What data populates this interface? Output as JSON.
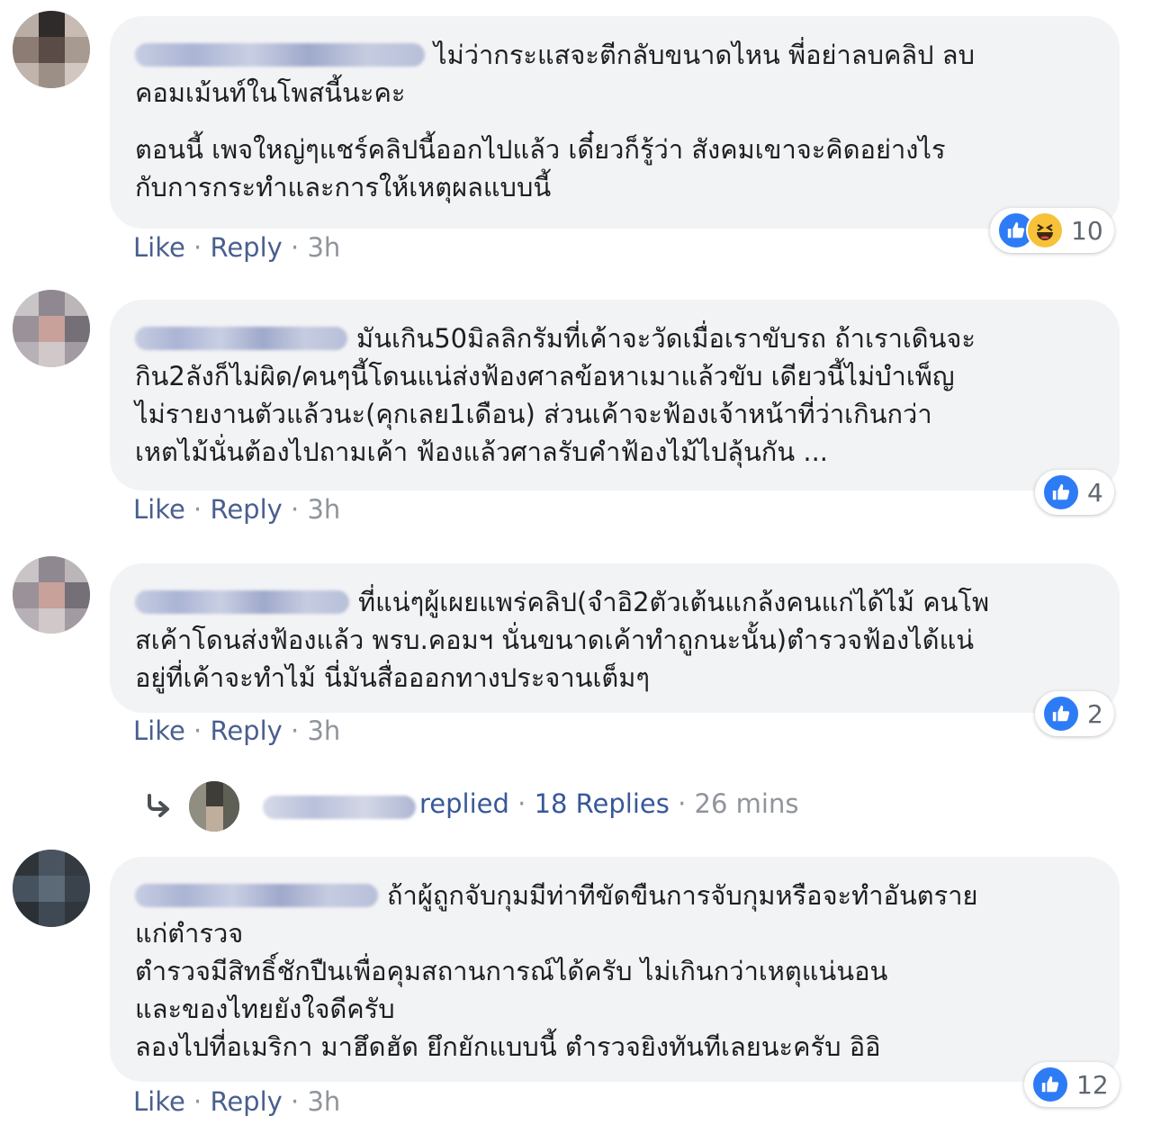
{
  "comments": [
    {
      "lines": [
        "ไม่ว่ากระแสจะตีกลับขนาดไหน พี่อย่าลบคลิป ลบ",
        "คอมเม้นท์ในโพสนี้นะคะ"
      ],
      "lines2": [
        "ตอนนี้ เพจใหญ่ๆแชร์คลิปนี้ออกไปแล้ว เดี๋ยวก็รู้ว่า สังคมเขาจะคิดอย่างไร",
        "กับการกระทำและการให้เหตุผลแบบนี้"
      ],
      "like": "Like",
      "reply": "Reply",
      "time": "3h",
      "reaction_count": "10"
    },
    {
      "lines": [
        "มันเกิน50มิลลิกรัมที่เค้าจะวัดเมื่อเราขับรถ ถ้าเราเดินจะ",
        "กิน2ลังก็ไม่ผิด/คนๆนี้โดนแน่ส่งฟ้องศาลข้อหาเมาแล้วขับ เดียวนี้ไม่บำเพ็ญ",
        "ไม่รายงานตัวแล้วนะ(คุกเลย1เดือน) ส่วนเค้าจะฟ้องเจ้าหน้าที่ว่าเกินกว่า",
        "เหตไม้นั่นต้องไปถามเค้า ฟ้องแล้วศาลรับคำฟ้องไม้ไปลุ้นกัน ..."
      ],
      "like": "Like",
      "reply": "Reply",
      "time": "3h",
      "reaction_count": "4"
    },
    {
      "lines": [
        "ที่แน่ๆผู้เผยแพร่คลิป(จำอิ2ตัวเต้นแกล้งคนแก่ได้ไม้ คนโพ",
        "สเค้าโดนส่งฟ้องแล้ว พรบ.คอมฯ นั่นขนาดเค้าทำถูกนะนั้น)ตำรวจฟ้องได้แน่",
        "อยู่ที่เค้าจะทำไม้ นี่มันสื่อออกทางประจานเต็มๆ"
      ],
      "like": "Like",
      "reply": "Reply",
      "time": "3h",
      "reaction_count": "2"
    },
    {
      "lines": [
        "ถ้าผู้ถูกจับกุมมีท่าทีขัดขืนการจับกุมหรือจะทำอันตราย",
        "แก่ตำรวจ",
        "ตำรวจมีสิทธิ์ชักปืนเพื่อคุมสถานการณ์ได้ครับ ไม่เกินกว่าเหตุแน่นอน",
        "และของไทยยังใจดีครับ",
        "ลองไปที่อเมริกา มาฮึดฮัด ยึกยักแบบนี้ ตำรวจยิงทันทีเลยนะครับ อิอิ"
      ],
      "like": "Like",
      "reply": "Reply",
      "time": "3h",
      "reaction_count": "12"
    }
  ],
  "replies_summary": {
    "replied": "replied",
    "count_label": "18 Replies",
    "time": "26 mins"
  },
  "colors": {
    "bubble": "#f2f3f5",
    "link": "#385898",
    "meta": "#90949c",
    "like_blue": "#2d7cf6",
    "haha_yellow": "#f7c23a"
  },
  "icons": {
    "reaction_like": "like-icon",
    "reaction_haha": "haha-icon",
    "reply_arrow": "reply-arrow-icon"
  }
}
